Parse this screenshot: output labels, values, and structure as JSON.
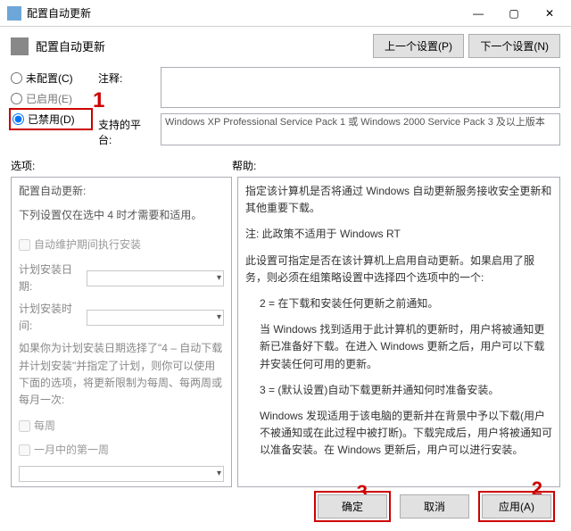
{
  "titlebar": {
    "title": "配置自动更新"
  },
  "header": {
    "title": "配置自动更新",
    "prev_btn": "上一个设置(P)",
    "next_btn": "下一个设置(N)"
  },
  "radios": {
    "not_configured": "未配置(C)",
    "enabled": "已启用(E)",
    "disabled": "已禁用(D)"
  },
  "config": {
    "comment_label": "注释:",
    "platform_label": "支持的平台:",
    "platform_text": "Windows XP Professional Service Pack 1 或 Windows 2000 Service Pack 3 及以上版本"
  },
  "columns": {
    "options_header": "选项:",
    "help_header": "帮助:"
  },
  "options": {
    "heading": "配置自动更新:",
    "note": "下列设置仅在选中 4 时才需要和适用。",
    "chk_maint": "自动维护期间执行安装",
    "sched_date_label": "计划安装日期:",
    "sched_time_label": "计划安装时间:",
    "long_note": "如果你为计划安装日期选择了\"4 – 自动下载并计划安装\"并指定了计划，则你可以使用下面的选项，将更新限制为每周、每两周或每月一次:",
    "chk_weekly": "每周",
    "chk_first_week": "一月中的第一周"
  },
  "help": {
    "p1": "指定该计算机是否将通过 Windows 自动更新服务接收安全更新和其他重要下载。",
    "p2": "注: 此政策不适用于 Windows RT",
    "p3": "此设置可指定是否在该计算机上启用自动更新。如果启用了服务，则必须在组策略设置中选择四个选项中的一个:",
    "p4": "2 = 在下载和安装任何更新之前通知。",
    "p5": "当 Windows 找到适用于此计算机的更新时，用户将被通知更新已准备好下载。在进入 Windows 更新之后，用户可以下载并安装任何可用的更新。",
    "p6": "3 = (默认设置)自动下载更新并通知何时准备安装。",
    "p7": "Windows 发现适用于该电脑的更新并在背景中予以下载(用户不被通知或在此过程中被打断)。下载完成后，用户将被通知可以准备安装。在 Windows 更新后，用户可以进行安装。"
  },
  "footer": {
    "ok": "确定",
    "cancel": "取消",
    "apply": "应用(A)"
  },
  "annotations": {
    "a1": "1",
    "a2": "2",
    "a3": "3"
  }
}
